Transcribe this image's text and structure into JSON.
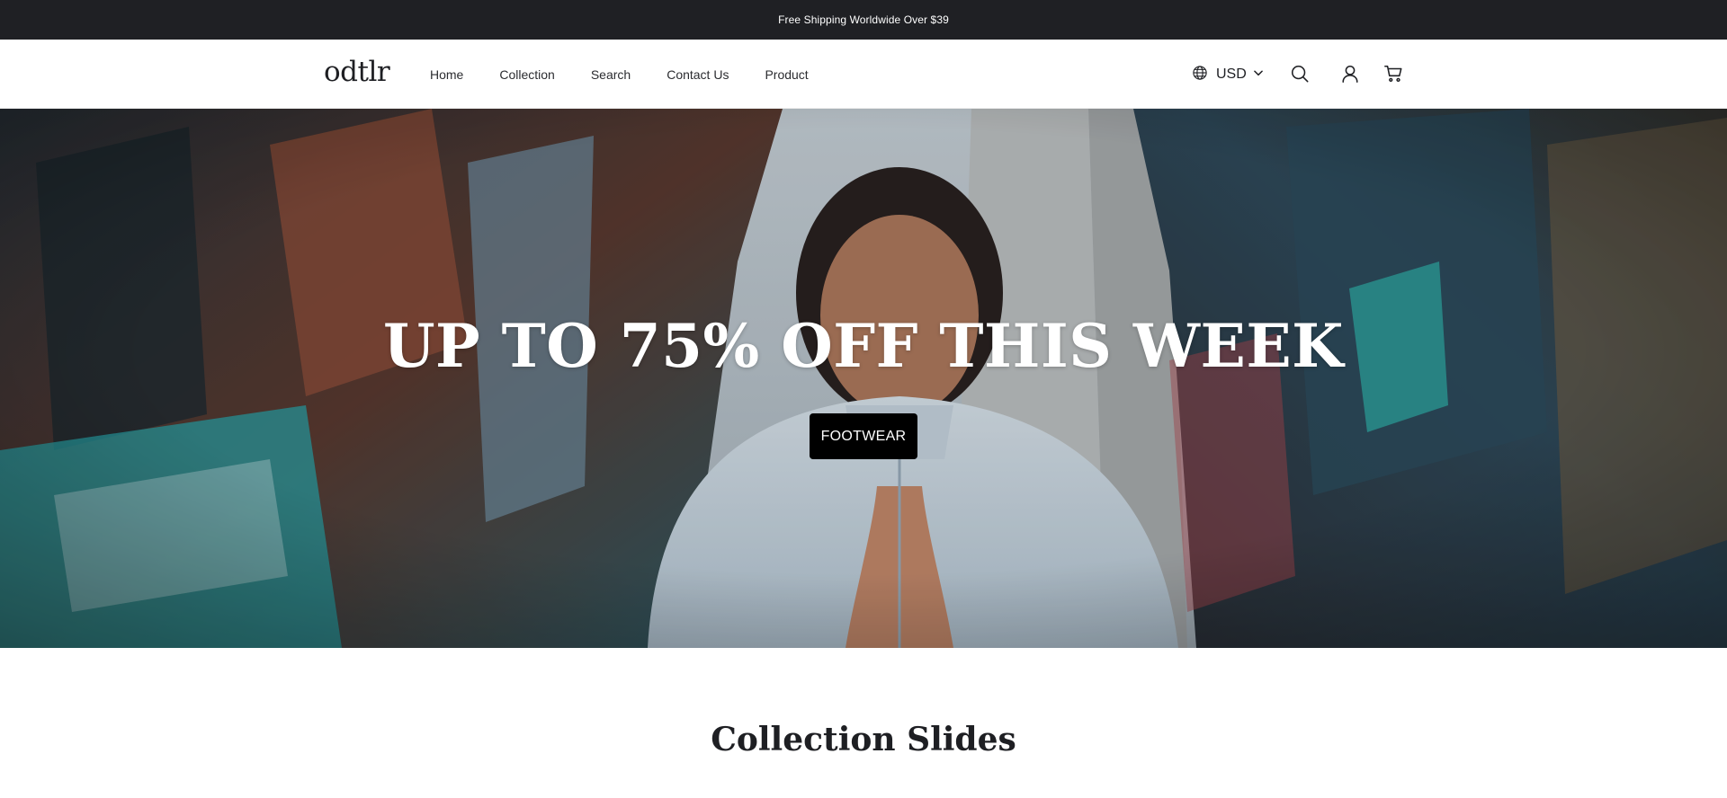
{
  "announcement": {
    "text": "Free Shipping Worldwide Over $39"
  },
  "header": {
    "logo": "odtlr",
    "nav": [
      {
        "label": "Home"
      },
      {
        "label": "Collection"
      },
      {
        "label": "Search"
      },
      {
        "label": "Contact Us"
      },
      {
        "label": "Product"
      }
    ],
    "currency": {
      "label": "USD",
      "icon": "globe-icon",
      "dropdown_icon": "chevron-down-icon"
    },
    "icons": [
      "search-icon",
      "account-icon",
      "cart-icon"
    ]
  },
  "hero": {
    "title": "UP TO 75% OFF THIS WEEK",
    "button_label": "FOOTWEAR"
  },
  "collection": {
    "title": "Collection Slides"
  },
  "colors": {
    "announcement_bg": "#1f2024",
    "button_bg": "#000000",
    "text": "#1e1f23"
  }
}
